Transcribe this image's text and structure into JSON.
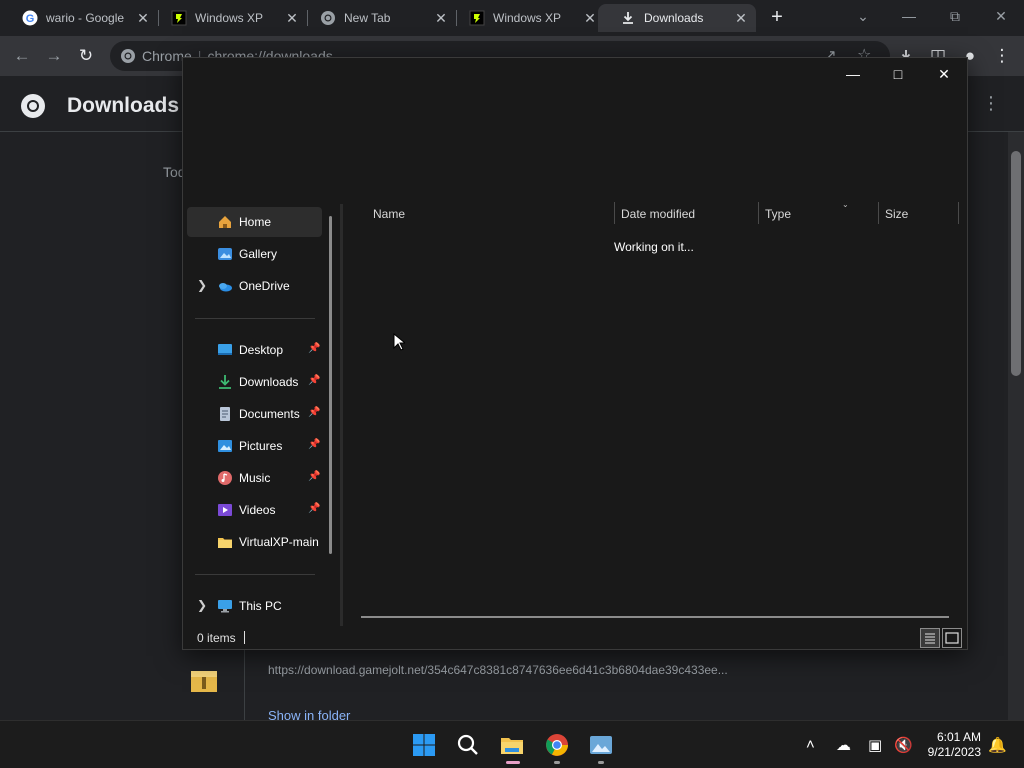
{
  "browser": {
    "tabs": [
      {
        "title": "wario - Google ",
        "icon": "google-icon",
        "close": "✕"
      },
      {
        "title": "Windows XP",
        "icon": "gamejolt-icon",
        "close": "✕"
      },
      {
        "title": "New Tab",
        "icon": "chrome-icon",
        "close": "✕"
      },
      {
        "title": "Windows XP",
        "icon": "gamejolt-icon",
        "close": "✕"
      },
      {
        "title": "Downloads",
        "icon": "download-icon",
        "close": "✕",
        "active": true
      }
    ],
    "new_tab": "+",
    "omnibox": {
      "host": "Chrome",
      "url": "chrome://downloads"
    }
  },
  "downloads_page": {
    "title": "Downloads",
    "date_label": "Tod",
    "item": {
      "url": "https://download.gamejolt.net/354c647c8381c8747636ee6d41c3b6804dae39c433ee...",
      "show_in_folder": "Show in folder"
    }
  },
  "explorer": {
    "nav": [
      {
        "label": "Home",
        "icon": "home-icon",
        "selected": true
      },
      {
        "label": "Gallery",
        "icon": "gallery-icon"
      },
      {
        "label": "OneDrive",
        "icon": "onedrive-icon",
        "expand": "›"
      },
      {
        "label": "Desktop",
        "icon": "desktop-icon",
        "pinned": true
      },
      {
        "label": "Downloads",
        "icon": "download-icon",
        "pinned": true
      },
      {
        "label": "Documents",
        "icon": "documents-icon",
        "pinned": true
      },
      {
        "label": "Pictures",
        "icon": "pictures-icon",
        "pinned": true
      },
      {
        "label": "Music",
        "icon": "music-icon",
        "pinned": true
      },
      {
        "label": "Videos",
        "icon": "videos-icon",
        "pinned": true
      },
      {
        "label": "VirtualXP-main",
        "icon": "folder-icon"
      },
      {
        "label": "This PC",
        "icon": "this-pc-icon",
        "expand": "›"
      }
    ],
    "columns": [
      "Name",
      "Date modified",
      "Type",
      "Size"
    ],
    "working_text": "Working on it...",
    "status": "0 items"
  },
  "taskbar": {
    "time": "6:01 AM",
    "date": "9/21/2023"
  },
  "colors": {
    "accent_blue": "#0078d4",
    "link": "#8ab4f8",
    "explorer_bg": "#191919",
    "browser_bg": "#202124"
  }
}
